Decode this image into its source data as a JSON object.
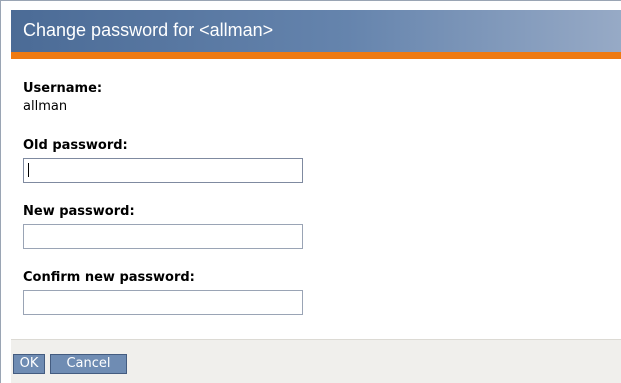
{
  "dialog": {
    "title": "Change password for <allman>"
  },
  "form": {
    "username_label": "Username:",
    "username_value": "allman",
    "old_password_label": "Old password:",
    "old_password_value": "",
    "new_password_label": "New password:",
    "new_password_value": "",
    "confirm_password_label": "Confirm new password:",
    "confirm_password_value": ""
  },
  "footer": {
    "ok_label": "OK",
    "cancel_label": "Cancel"
  },
  "colors": {
    "titlebar": "#4b6b96",
    "accent": "#ee7a12",
    "button": "#6f8cb3",
    "footer_bg": "#f0efec"
  }
}
